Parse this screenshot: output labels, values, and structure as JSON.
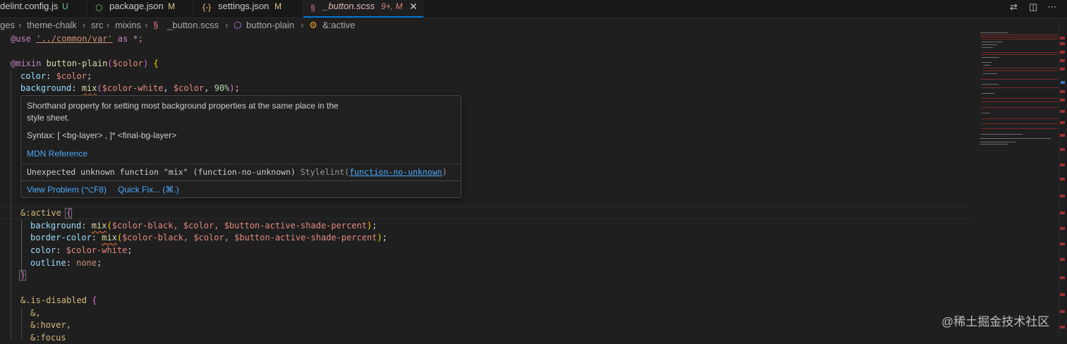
{
  "tabs": [
    {
      "name": "delint.config.js",
      "status": "U",
      "icon": "js-file-icon"
    },
    {
      "name": "package.json",
      "status": "M",
      "icon": "npm-package-icon"
    },
    {
      "name": "settings.json",
      "status": "M",
      "icon": "json-braces-icon"
    },
    {
      "name": "_button.scss",
      "status": "9+, M",
      "icon": "scss-file-icon",
      "active": true
    }
  ],
  "tab_close_glyph": "✕",
  "json_icon_glyph": "{-}",
  "breadcrumb": [
    "ges",
    "theme-chalk",
    "src",
    "mixins",
    "_button.scss",
    "button-plain",
    "&:active"
  ],
  "code": {
    "l1_kw": "@use",
    "l1_str": "'../common/var'",
    "l1_rest": "as *;",
    "l2_kw": "@mixin",
    "l2_fn": "button-plain",
    "l2_open": "(",
    "l2_var": "$color",
    "l2_close": ")",
    "l2_brace": "{",
    "l3_prop": "color",
    "l3_val": "$color",
    "l4_prop": "background",
    "l4_fn": "mix",
    "l4_arg1": "$color-white",
    "l4_arg2": "$color",
    "l4_num": "90%",
    "a_sel": "&:active",
    "a_brace": "{",
    "a1_prop": "background",
    "a1_fn": "mix",
    "a1_args": "$color-black, $color, $button-active-shade-percent",
    "a2_prop": "border-color",
    "a2_fn": "mix",
    "a2_args": "$color-black, $color, $button-active-shade-percent",
    "a3_prop": "color",
    "a3_val": "$color-white",
    "a4_prop": "outline",
    "a4_val": "none",
    "a_close": "}",
    "d_sel": "&.is-disabled",
    "d_brace": "{",
    "d1": "&,",
    "d2": "&:hover,",
    "d3": "&:focus"
  },
  "hover": {
    "desc_line1": "Shorthand property for setting most background properties at the same place in the",
    "desc_line2": "style sheet.",
    "syntax": "Syntax: [ <bg-layer> , ]* <final-bg-layer>",
    "mdn": "MDN Reference",
    "error_msg": "Unexpected unknown function \"mix\" (function-no-unknown)",
    "error_source": "Stylelint(",
    "error_link": "function-no-unknown",
    "error_close": ")",
    "view_problem": "View Problem (⌥F8)",
    "quick_fix": "Quick Fix... (⌘.)"
  },
  "watermark": "@稀土掘金技术社区"
}
